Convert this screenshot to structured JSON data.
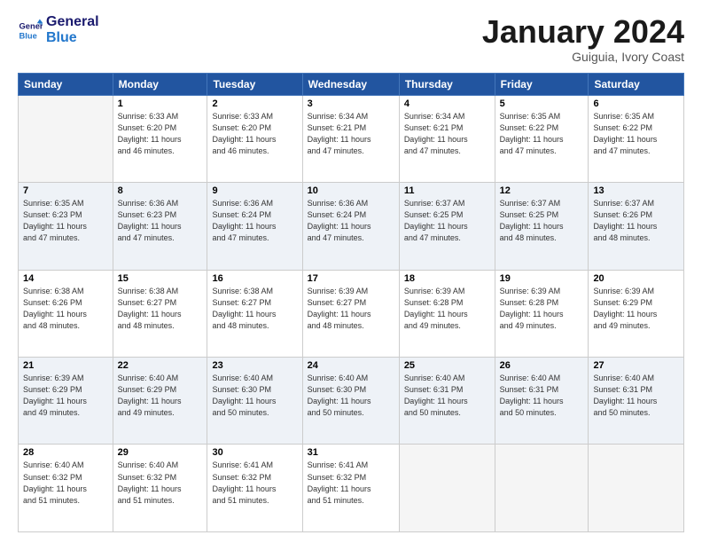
{
  "header": {
    "logo_line1": "General",
    "logo_line2": "Blue",
    "month": "January 2024",
    "location": "Guiguia, Ivory Coast"
  },
  "days_of_week": [
    "Sunday",
    "Monday",
    "Tuesday",
    "Wednesday",
    "Thursday",
    "Friday",
    "Saturday"
  ],
  "weeks": [
    [
      {
        "day": "",
        "info": ""
      },
      {
        "day": "1",
        "info": "Sunrise: 6:33 AM\nSunset: 6:20 PM\nDaylight: 11 hours\nand 46 minutes."
      },
      {
        "day": "2",
        "info": "Sunrise: 6:33 AM\nSunset: 6:20 PM\nDaylight: 11 hours\nand 46 minutes."
      },
      {
        "day": "3",
        "info": "Sunrise: 6:34 AM\nSunset: 6:21 PM\nDaylight: 11 hours\nand 47 minutes."
      },
      {
        "day": "4",
        "info": "Sunrise: 6:34 AM\nSunset: 6:21 PM\nDaylight: 11 hours\nand 47 minutes."
      },
      {
        "day": "5",
        "info": "Sunrise: 6:35 AM\nSunset: 6:22 PM\nDaylight: 11 hours\nand 47 minutes."
      },
      {
        "day": "6",
        "info": "Sunrise: 6:35 AM\nSunset: 6:22 PM\nDaylight: 11 hours\nand 47 minutes."
      }
    ],
    [
      {
        "day": "7",
        "info": "Sunrise: 6:35 AM\nSunset: 6:23 PM\nDaylight: 11 hours\nand 47 minutes."
      },
      {
        "day": "8",
        "info": "Sunrise: 6:36 AM\nSunset: 6:23 PM\nDaylight: 11 hours\nand 47 minutes."
      },
      {
        "day": "9",
        "info": "Sunrise: 6:36 AM\nSunset: 6:24 PM\nDaylight: 11 hours\nand 47 minutes."
      },
      {
        "day": "10",
        "info": "Sunrise: 6:36 AM\nSunset: 6:24 PM\nDaylight: 11 hours\nand 47 minutes."
      },
      {
        "day": "11",
        "info": "Sunrise: 6:37 AM\nSunset: 6:25 PM\nDaylight: 11 hours\nand 47 minutes."
      },
      {
        "day": "12",
        "info": "Sunrise: 6:37 AM\nSunset: 6:25 PM\nDaylight: 11 hours\nand 48 minutes."
      },
      {
        "day": "13",
        "info": "Sunrise: 6:37 AM\nSunset: 6:26 PM\nDaylight: 11 hours\nand 48 minutes."
      }
    ],
    [
      {
        "day": "14",
        "info": "Sunrise: 6:38 AM\nSunset: 6:26 PM\nDaylight: 11 hours\nand 48 minutes."
      },
      {
        "day": "15",
        "info": "Sunrise: 6:38 AM\nSunset: 6:27 PM\nDaylight: 11 hours\nand 48 minutes."
      },
      {
        "day": "16",
        "info": "Sunrise: 6:38 AM\nSunset: 6:27 PM\nDaylight: 11 hours\nand 48 minutes."
      },
      {
        "day": "17",
        "info": "Sunrise: 6:39 AM\nSunset: 6:27 PM\nDaylight: 11 hours\nand 48 minutes."
      },
      {
        "day": "18",
        "info": "Sunrise: 6:39 AM\nSunset: 6:28 PM\nDaylight: 11 hours\nand 49 minutes."
      },
      {
        "day": "19",
        "info": "Sunrise: 6:39 AM\nSunset: 6:28 PM\nDaylight: 11 hours\nand 49 minutes."
      },
      {
        "day": "20",
        "info": "Sunrise: 6:39 AM\nSunset: 6:29 PM\nDaylight: 11 hours\nand 49 minutes."
      }
    ],
    [
      {
        "day": "21",
        "info": "Sunrise: 6:39 AM\nSunset: 6:29 PM\nDaylight: 11 hours\nand 49 minutes."
      },
      {
        "day": "22",
        "info": "Sunrise: 6:40 AM\nSunset: 6:29 PM\nDaylight: 11 hours\nand 49 minutes."
      },
      {
        "day": "23",
        "info": "Sunrise: 6:40 AM\nSunset: 6:30 PM\nDaylight: 11 hours\nand 50 minutes."
      },
      {
        "day": "24",
        "info": "Sunrise: 6:40 AM\nSunset: 6:30 PM\nDaylight: 11 hours\nand 50 minutes."
      },
      {
        "day": "25",
        "info": "Sunrise: 6:40 AM\nSunset: 6:31 PM\nDaylight: 11 hours\nand 50 minutes."
      },
      {
        "day": "26",
        "info": "Sunrise: 6:40 AM\nSunset: 6:31 PM\nDaylight: 11 hours\nand 50 minutes."
      },
      {
        "day": "27",
        "info": "Sunrise: 6:40 AM\nSunset: 6:31 PM\nDaylight: 11 hours\nand 50 minutes."
      }
    ],
    [
      {
        "day": "28",
        "info": "Sunrise: 6:40 AM\nSunset: 6:32 PM\nDaylight: 11 hours\nand 51 minutes."
      },
      {
        "day": "29",
        "info": "Sunrise: 6:40 AM\nSunset: 6:32 PM\nDaylight: 11 hours\nand 51 minutes."
      },
      {
        "day": "30",
        "info": "Sunrise: 6:41 AM\nSunset: 6:32 PM\nDaylight: 11 hours\nand 51 minutes."
      },
      {
        "day": "31",
        "info": "Sunrise: 6:41 AM\nSunset: 6:32 PM\nDaylight: 11 hours\nand 51 minutes."
      },
      {
        "day": "",
        "info": ""
      },
      {
        "day": "",
        "info": ""
      },
      {
        "day": "",
        "info": ""
      }
    ]
  ],
  "colors": {
    "header_bg": "#2255a0",
    "header_text": "#ffffff",
    "border": "#cccccc",
    "title": "#1a1a1a",
    "logo_dark": "#1a1a6e",
    "logo_light": "#2277cc"
  }
}
